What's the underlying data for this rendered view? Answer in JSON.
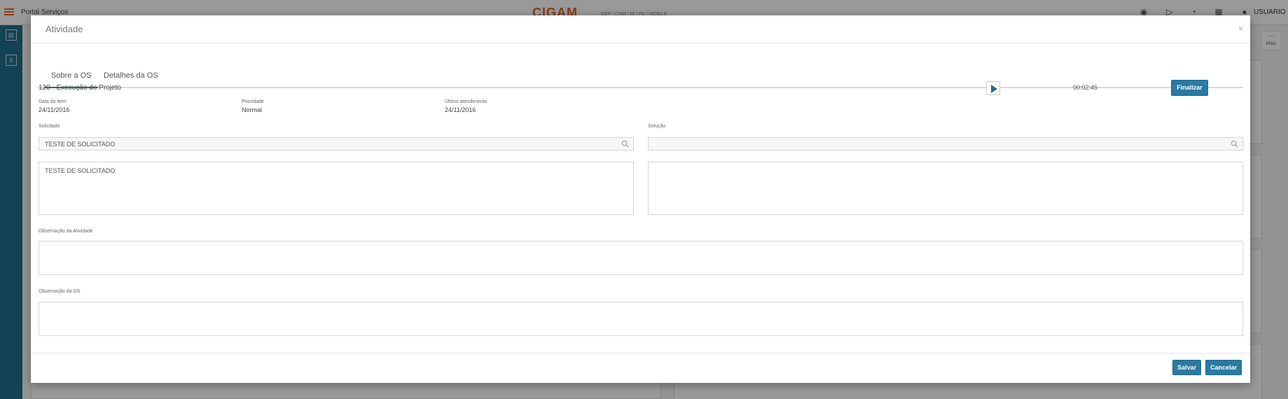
{
  "app": {
    "title": "Portal Serviços",
    "logo": "CIGAM",
    "logo_sub": "ERP | CRM | BI | PA | MOBILE",
    "user": "USUARIO",
    "more_label": "Mais"
  },
  "modal": {
    "title": "Atividade",
    "close": "×",
    "tabs": [
      {
        "label": "Sobre a OS",
        "active": true
      },
      {
        "label": "Detalhes da OS",
        "active": false
      }
    ],
    "activity": {
      "title": "120 - Execução de Projeto",
      "timer": "00:02:45",
      "finalize_label": "Finalizar",
      "meta": [
        {
          "label": "Data do item",
          "value": "24/11/2016"
        },
        {
          "label": "Prioridade",
          "value": "Normal"
        },
        {
          "label": "Último atendimento",
          "value": "24/11/2016"
        }
      ]
    },
    "solicitado": {
      "label": "Solicitado",
      "lookup_value": "TESTE DE SOLICITADO",
      "text_value": "TESTE DE SOLICITADO"
    },
    "solucao": {
      "label": "Solução",
      "lookup_value": "",
      "text_value": ""
    },
    "obs_atividade": {
      "label": "Observação da Atividade",
      "value": ""
    },
    "obs_os": {
      "label": "Observação da OS",
      "value": ""
    },
    "footer": {
      "save_label": "Salvar",
      "cancel_label": "Cancelar"
    }
  },
  "colors": {
    "primary": "#2a7aa1",
    "sidebar": "#1f6f8b",
    "brand": "#e0661a"
  }
}
